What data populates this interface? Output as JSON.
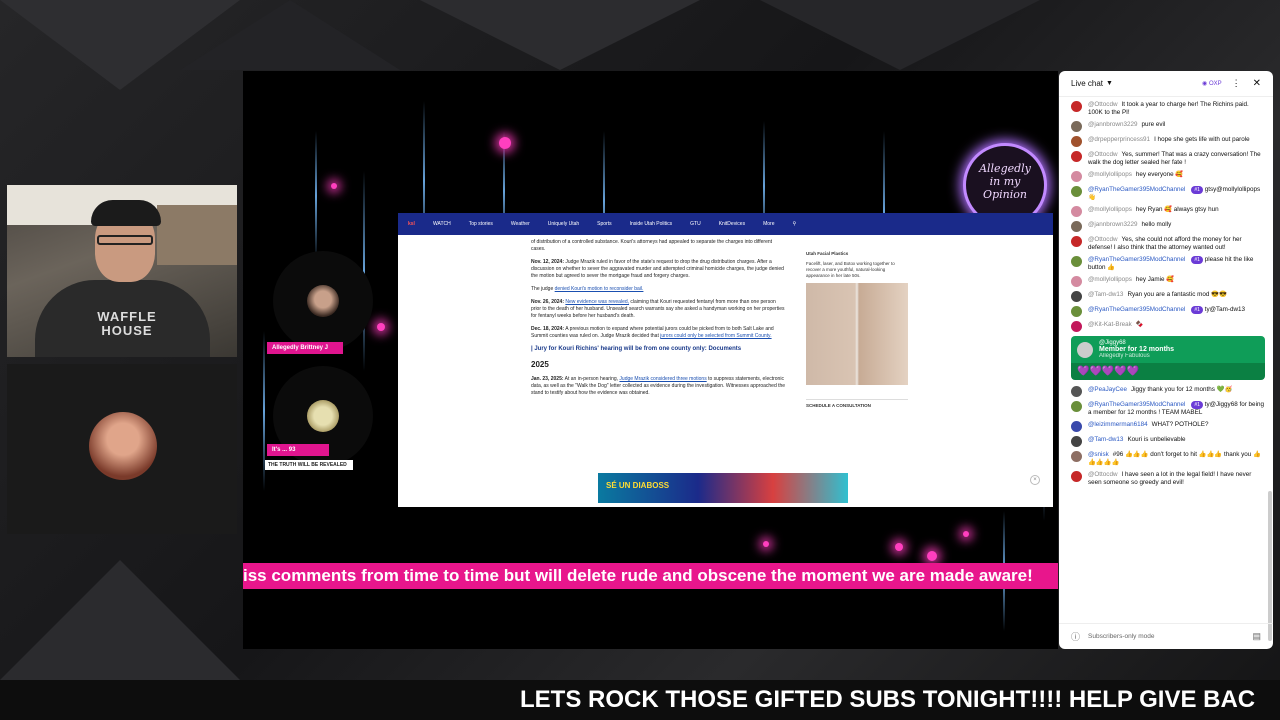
{
  "ticker": {
    "text": "iss comments from time to time but will delete rude and obscene the moment we are made aware!"
  },
  "bottom_banner": {
    "text": "LETS ROCK THOSE GIFTED SUBS TONIGHT!!!! HELP GIVE BAC"
  },
  "logo": {
    "line1": "Allegedly",
    "line2": "in my",
    "line3": "Opinion"
  },
  "guests": [
    {
      "label": "Allegedly Brittney J"
    },
    {
      "label": "It's ... 93",
      "tagline": "THE TRUTH WILL BE REVEALED"
    }
  ],
  "browser": {
    "nav_items": [
      "WATCH",
      "Top stories",
      "Weather",
      "Uniquely Utah",
      "Sports",
      "Inside Utah Politics",
      "GTU",
      "KnitDevices",
      "More"
    ],
    "article": {
      "p0": "of distribution of a controlled substance. Kouri's attorneys had appealed to separate the charges into different cases.",
      "p1_date": "Nov. 12, 2024:",
      "p1": "Judge Mrazik ruled in favor of the state's request to drop the drug distribution charges. After a discussion on whether to sever the aggravated murder and attempted criminal homicide charges, the judge denied the motion but agreed to sever the mortgage fraud and forgery charges.",
      "p2_prefix": "The judge",
      "p2_link": "denied Kouri's motion to reconsider bail.",
      "p3_date": "Nov. 26, 2024:",
      "p3_link": "New evidence was revealed,",
      "p3": "claiming that Kouri requested fentanyl from more than one person prior to the death of her husband. Unsealed search warrants say she asked a handyman working on her properties for fentanyl weeks before her husband's death.",
      "p4_date": "Dec. 18, 2024:",
      "p4": "A previous motion to expand where potential jurors could be picked from to both Salt Lake and Summit counties was ruled on. Judge Mrazik decided that",
      "p4_link": "jurors could only be selected from Summit County.",
      "related": "| Jury for Kouri Richins' hearing will be from one county only: Documents",
      "year": "2025",
      "p5_date": "Jan. 23, 2025:",
      "p5_a": "At an in-person hearing,",
      "p5_link": "Judge Mrazik considered three motions",
      "p5": "to suppress statements, electronic data, as well as the \"Walk the Dog\" letter collected as evidence during the investigation. Witnesses approached the stand to testify about how the evidence was obtained."
    },
    "ad": {
      "brand": "Utah Facial Plastics",
      "text": "Facelift, laser, and Botox working together to recover a more youthful, natural-looking appearance in her late 50s.",
      "cta": "SCHEDULE A CONSULTATION"
    },
    "bottom_ad": {
      "text": "SÉ UN DIABOSS"
    }
  },
  "chat": {
    "title": "Live chat",
    "points": "OXP",
    "footer_placeholder": "Subscribers-only mode",
    "messages": [
      {
        "author": "@Ottocdw",
        "text": "It took a year to charge her! The Richins paid. 100K to the PI!",
        "color": "#c62828"
      },
      {
        "author": "@jannbrown3229",
        "text": "pure evil",
        "color": "#7a6a5a"
      },
      {
        "author": "@drpepperprincess91",
        "text": "I hope she gets life with out parole",
        "color": "#a0522d"
      },
      {
        "author": "@Ottocdw",
        "text": "Yes, summer! That was a crazy conversation! The walk the dog letter sealed her fate !",
        "color": "#c62828"
      },
      {
        "author": "@mollylollipops",
        "text": "hey everyone 🥰",
        "color": "#d48aa0"
      },
      {
        "author": "@RyanTheGamer395ModChannel",
        "badge": "#1",
        "text": "gtsy@mollylollipops 👋",
        "color": "#6a8f3a",
        "blue": true
      },
      {
        "author": "@mollylollipops",
        "text": "hey Ryan 🥰 always gtsy hun",
        "color": "#d48aa0"
      },
      {
        "author": "@jannbrown3229",
        "text": "hello molly",
        "color": "#7a6a5a"
      },
      {
        "author": "@Ottocdw",
        "text": "Yes, she could not afford the money for her defense! I also think that the attorney wanted out!",
        "color": "#c62828"
      },
      {
        "author": "@RyanTheGamer395ModChannel",
        "badge": "#1",
        "text": "please hit the like button 👍",
        "color": "#6a8f3a",
        "blue": true
      },
      {
        "author": "@mollylollipops",
        "text": "hey Jamie 🥰",
        "color": "#d48aa0"
      },
      {
        "author": "@Tam-dw13",
        "text": "Ryan you are a fantastic mod 😎😎",
        "color": "#444"
      },
      {
        "author": "@RyanTheGamer395ModChannel",
        "badge": "#1",
        "text": "ty@Tam-dw13",
        "color": "#6a8f3a",
        "blue": true
      },
      {
        "author": "@Kit-Kat-Break",
        "text": "🍫",
        "color": "#c2185b"
      }
    ],
    "member": {
      "name": "@Jiggy68",
      "title": "Member for 12 months",
      "sub": "Allegedly Fabulous",
      "emotes": "💜💜💜💜💜"
    },
    "messages2": [
      {
        "author": "@PeaJayCee",
        "text": "Jiggy thank you for 12 months 💚🥳",
        "color": "#555",
        "blue": true
      },
      {
        "author": "@RyanTheGamer395ModChannel",
        "badge": "#1",
        "text": "ty@Jiggy68 for being a member for 12 months ! TEAM MABEL",
        "color": "#6a8f3a",
        "blue": true
      },
      {
        "author": "@leizimmerman6184",
        "text": "WHAT? POTHOLE?",
        "color": "#3949ab",
        "blue": true
      },
      {
        "author": "@Tam-dw13",
        "text": "Kouri is unbelievable",
        "color": "#444",
        "blue": true
      },
      {
        "author": "@snisk",
        "text": "#96 👍👍👍 don't forget to hit 👍👍👍 thank you 👍👍👍👍👍",
        "color": "#8d6e63",
        "blue": true
      },
      {
        "author": "@Ottocdw",
        "text": "I have seen a lot in the legal field! I have never seen someone so greedy and evil!",
        "color": "#c62828"
      }
    ]
  }
}
